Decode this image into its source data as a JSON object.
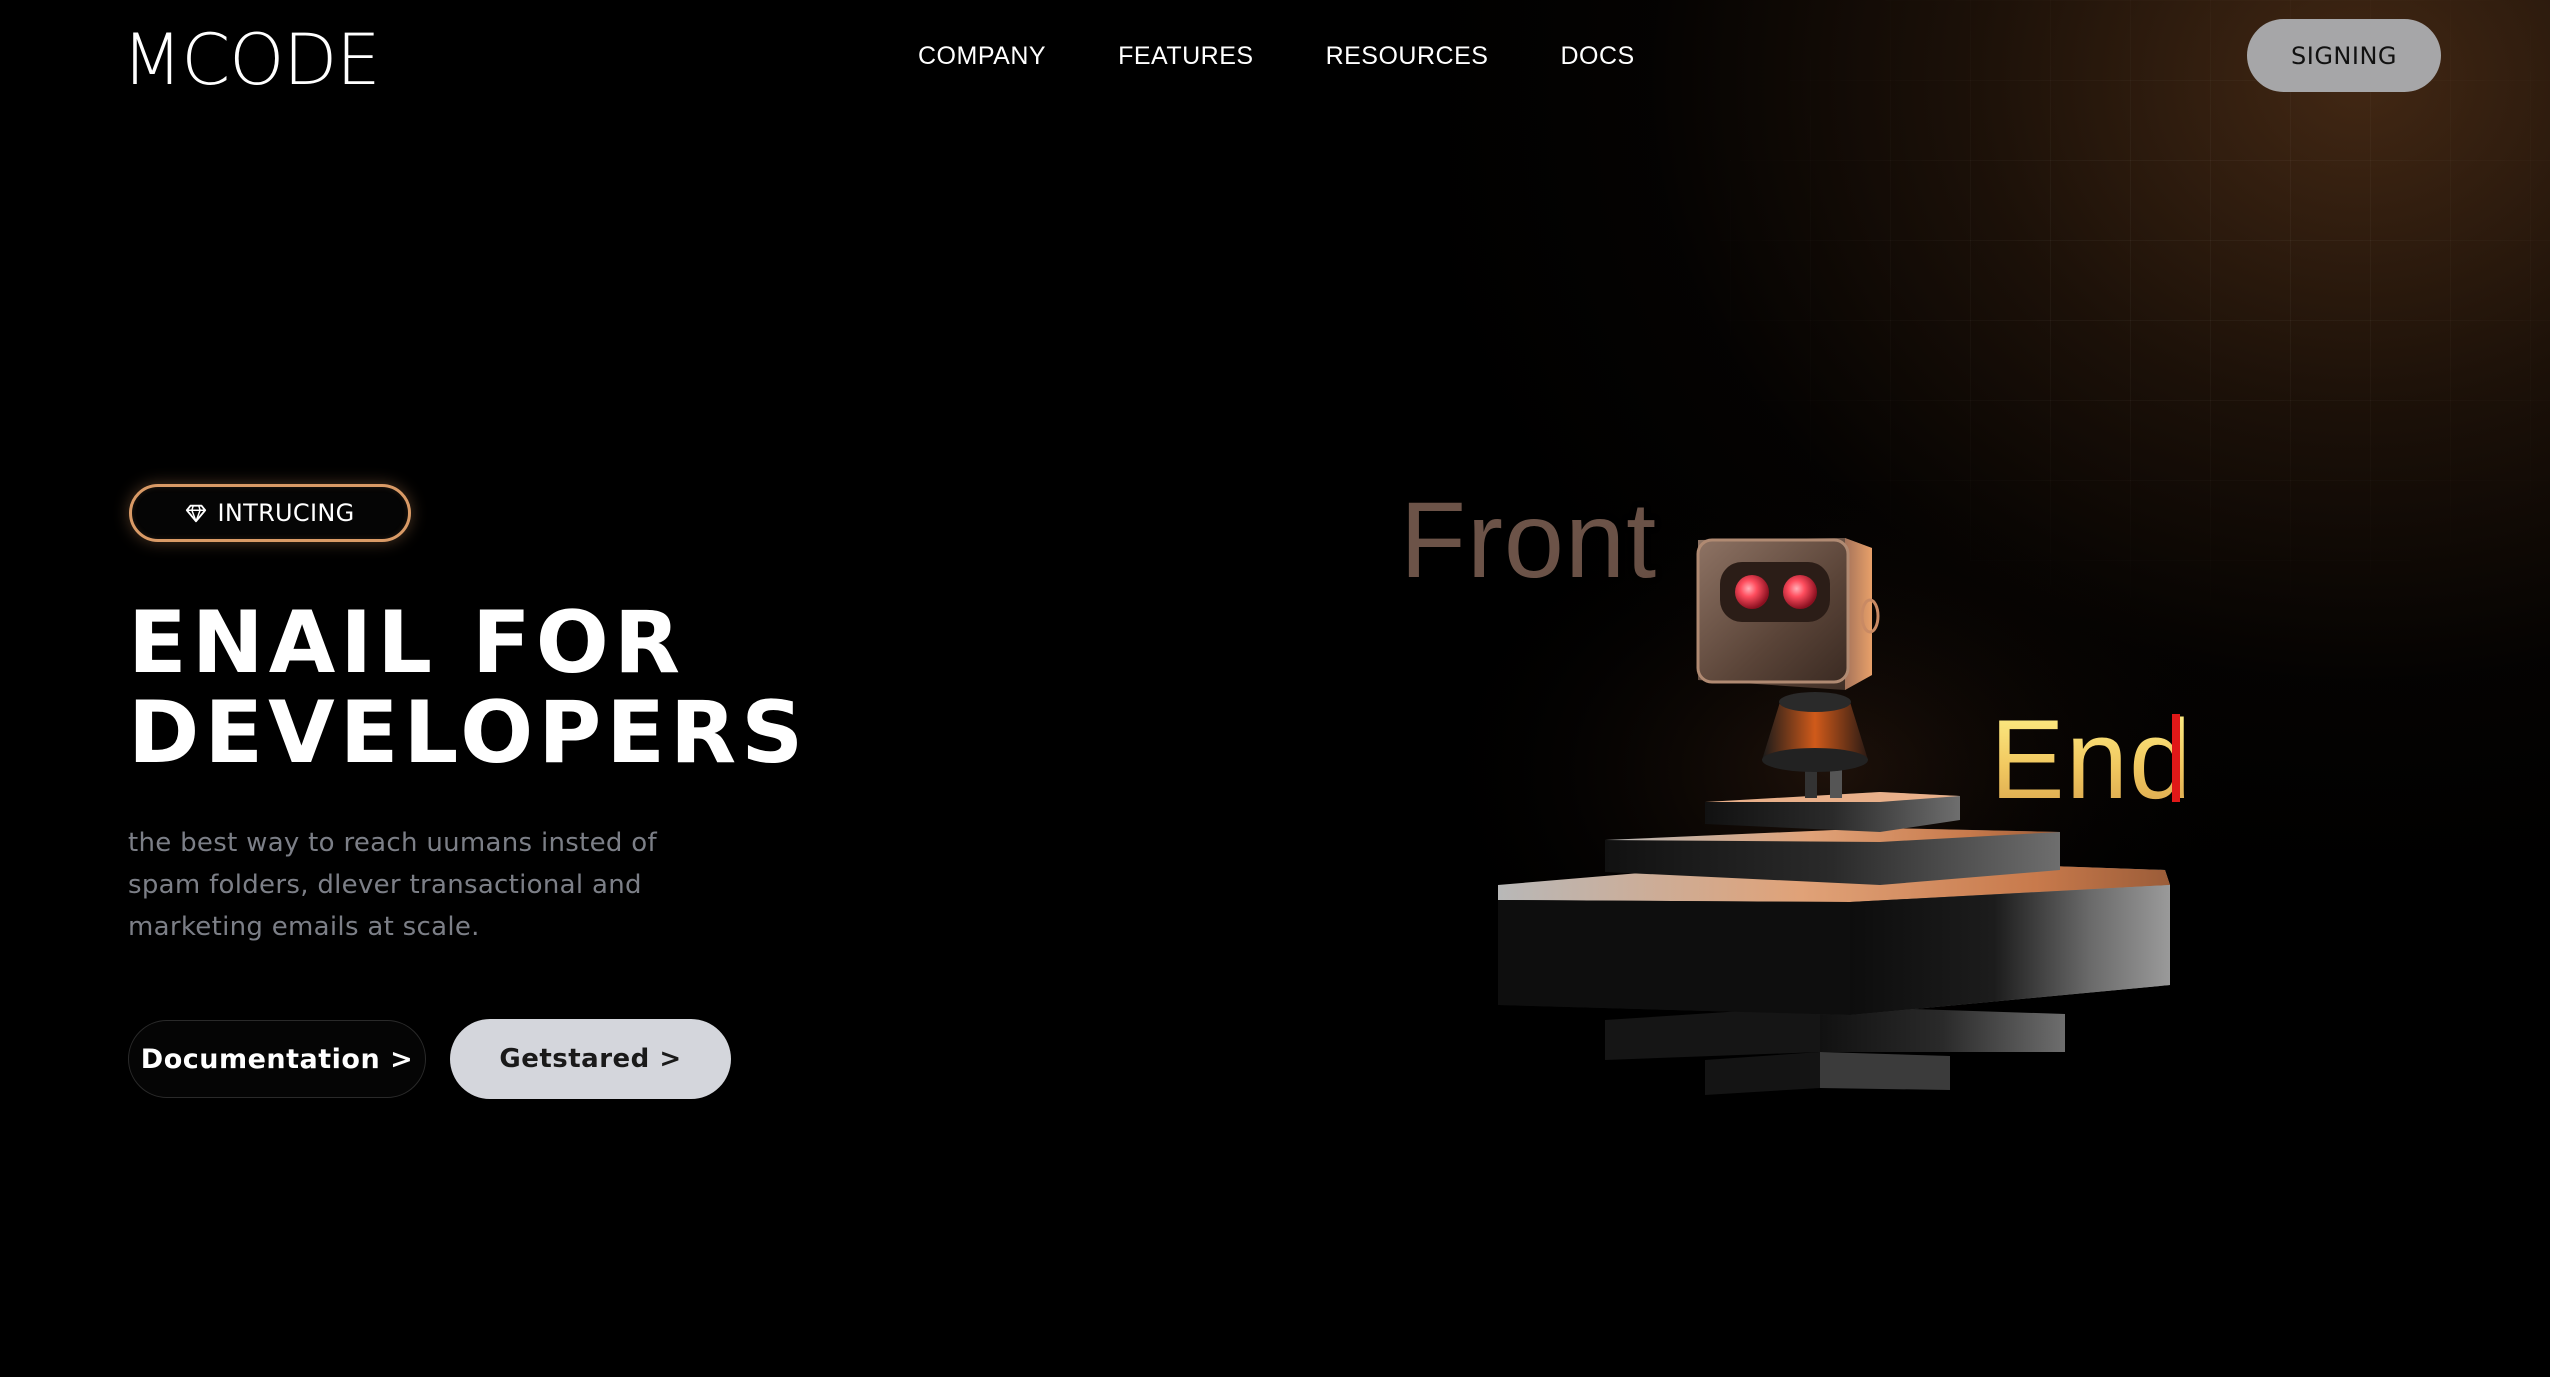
{
  "header": {
    "logo": "MCODE",
    "nav": [
      "COMPANY",
      "FEATURES",
      "RESOURCES",
      "DOCS"
    ],
    "signin_label": "SIGNING"
  },
  "hero": {
    "badge": {
      "icon": "diamond-icon",
      "label": "INTRUCING"
    },
    "title_lines": [
      "ENAIL FOR",
      "DEVELOPERS"
    ],
    "description": "the best way to reach uumans insted of spam folders, dlever transactional and marketing emails at scale.",
    "buttons": {
      "documentation": "Documentation >",
      "get_started": "Getstared >"
    }
  },
  "illustration": {
    "word_front": "Front",
    "word_end": "End",
    "subject": "robot-on-pedestal",
    "colors": {
      "accent_copper": "#d99a66",
      "end_text": "#f1c860",
      "robot_eyes": "#ff4d5e",
      "cursor": "#e01818"
    }
  }
}
